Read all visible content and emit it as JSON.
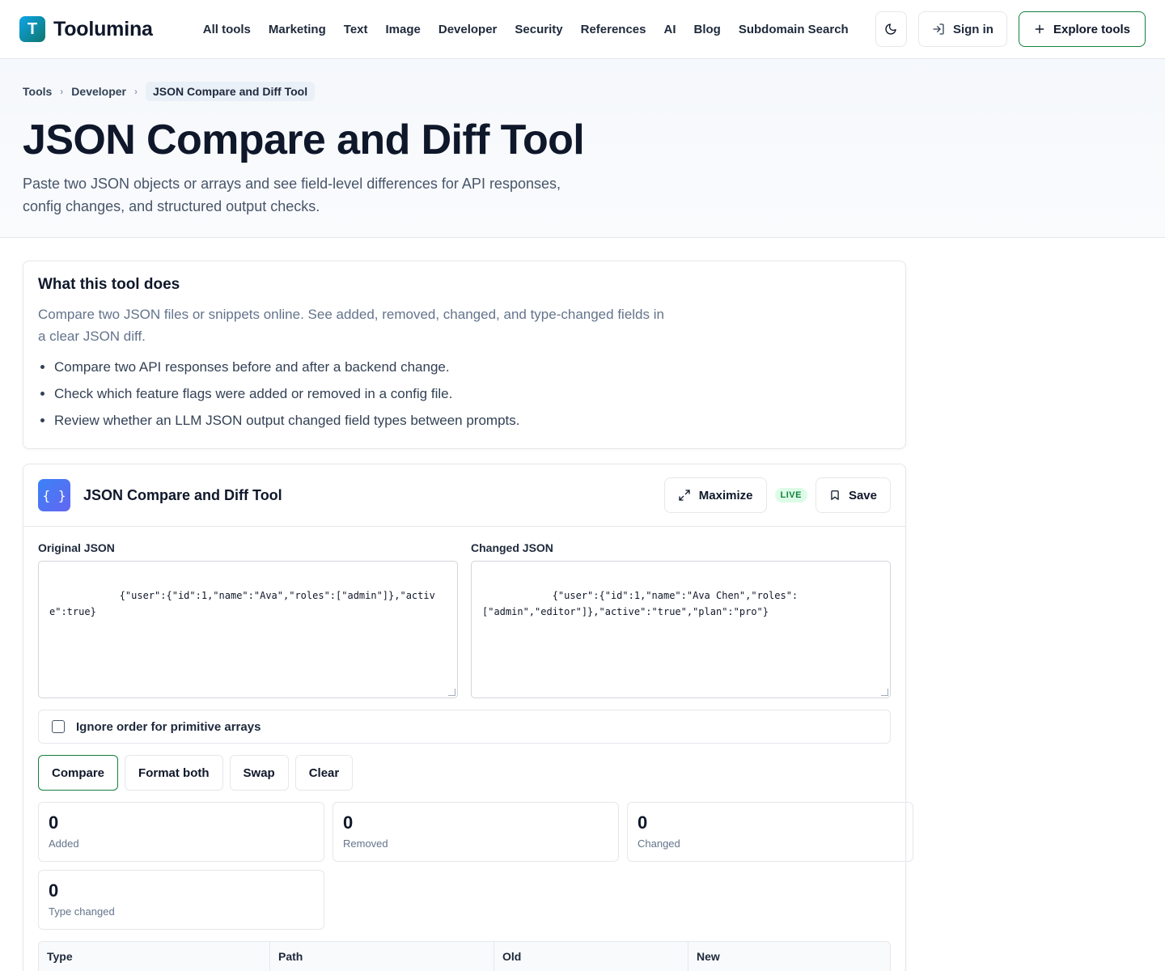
{
  "brand": {
    "logo_letter": "T",
    "name": "Toolumina"
  },
  "nav": [
    "All tools",
    "Marketing",
    "Text",
    "Image",
    "Developer",
    "Security",
    "References",
    "AI",
    "Blog",
    "Subdomain Search"
  ],
  "header": {
    "sign_in": "Sign in",
    "explore": "Explore tools"
  },
  "breadcrumb": [
    "Tools",
    "Developer",
    "JSON Compare and Diff Tool"
  ],
  "hero": {
    "title": "JSON Compare and Diff Tool",
    "subtitle": "Paste two JSON objects or arrays and see field-level differences for API responses, config changes, and structured output checks."
  },
  "info": {
    "heading": "What this tool does",
    "description": "Compare two JSON files or snippets online. See added, removed, changed, and type-changed fields in a clear JSON diff.",
    "bullets": [
      "Compare two API responses before and after a backend change.",
      "Check which feature flags were added or removed in a config file.",
      "Review whether an LLM JSON output changed field types between prompts."
    ]
  },
  "tool": {
    "icon_text": "{ }",
    "title": "JSON Compare and Diff Tool",
    "maximize": "Maximize",
    "live": "LIVE",
    "save": "Save",
    "original_label": "Original JSON",
    "original_value": "{\"user\":{\"id\":1,\"name\":\"Ava\",\"roles\":[\"admin\"]},\"active\":true}",
    "changed_label": "Changed JSON",
    "changed_value": "{\"user\":{\"id\":1,\"name\":\"Ava Chen\",\"roles\":\n[\"admin\",\"editor\"]},\"active\":\"true\",\"plan\":\"pro\"}",
    "ignore_order_label": "Ignore order for primitive arrays",
    "ignore_order_checked": false,
    "buttons": {
      "compare": "Compare",
      "format": "Format both",
      "swap": "Swap",
      "clear": "Clear"
    },
    "stats": [
      {
        "value": "0",
        "label": "Added"
      },
      {
        "value": "0",
        "label": "Removed"
      },
      {
        "value": "0",
        "label": "Changed"
      },
      {
        "value": "0",
        "label": "Type changed"
      }
    ],
    "table_headers": [
      "Type",
      "Path",
      "Old",
      "New"
    ]
  },
  "colors": {
    "accent": "#15803d",
    "tool_icon": "#4f46e5",
    "brand": "#0ea5e9"
  }
}
